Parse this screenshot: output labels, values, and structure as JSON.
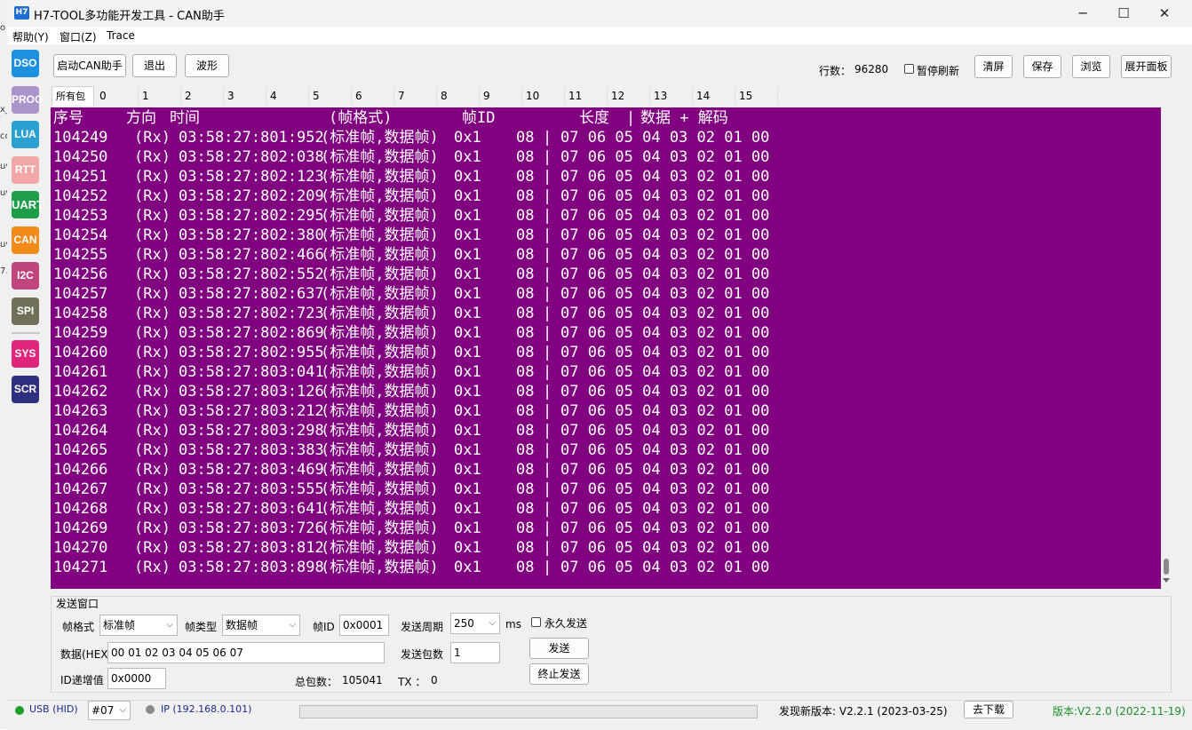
{
  "background_strip": [
    "o",
    "x_",
    "cc",
    "uv",
    "uv",
    "uv",
    "7."
  ],
  "window": {
    "logo": "H7",
    "title": "H7-TOOL多功能开发工具 - CAN助手",
    "minimize": "─",
    "maximize": "☐",
    "close": "✕"
  },
  "menu": [
    "帮助(Y)",
    "窗口(Z)",
    "Trace"
  ],
  "sidebar": [
    {
      "label": "DSO",
      "color": "#1e90e0"
    },
    {
      "label": "PROG",
      "color": "#a995c9"
    },
    {
      "label": "LUA",
      "color": "#2a9fd0"
    },
    {
      "label": "RTT",
      "color": "#f2a7a7"
    },
    {
      "label": "UART",
      "color": "#1e9e4a"
    },
    {
      "label": "CAN",
      "color": "#f08a1a"
    },
    {
      "label": "I2C",
      "color": "#c0457c"
    },
    {
      "label": "SPI",
      "color": "#6f6f5a"
    },
    {
      "label": "SYS",
      "color": "#e0257c"
    },
    {
      "label": "SCR",
      "color": "#2e2f7e"
    }
  ],
  "toolbar": {
    "start": "启动CAN助手",
    "exit": "退出",
    "wave": "波形",
    "rows_label": "行数：",
    "rows_value": "96280",
    "pause_label": "暂停刷新",
    "clear": "清屏",
    "save": "保存",
    "browse": "浏览",
    "expand": "展开面板"
  },
  "tabs": [
    "所有包",
    "0",
    "1",
    "2",
    "3",
    "4",
    "5",
    "6",
    "7",
    "8",
    "9",
    "10",
    "11",
    "12",
    "13",
    "14",
    "15"
  ],
  "log": {
    "header": {
      "seq": "序号",
      "dir": "方向",
      "time": "时间",
      "fmt": "(帧格式)",
      "id": "帧ID",
      "len": "长度",
      "sep": "|",
      "data": "数据 + 解码"
    },
    "rows": [
      {
        "seq": "104249",
        "dir": "(Rx)",
        "time": "03:58:27:801:952",
        "fmt": "(标准帧,数据帧)",
        "id": "0x1",
        "len": "08",
        "data": "07 06 05 04 03 02 01 00"
      },
      {
        "seq": "104250",
        "dir": "(Rx)",
        "time": "03:58:27:802:038",
        "fmt": "(标准帧,数据帧)",
        "id": "0x1",
        "len": "08",
        "data": "07 06 05 04 03 02 01 00"
      },
      {
        "seq": "104251",
        "dir": "(Rx)",
        "time": "03:58:27:802:123",
        "fmt": "(标准帧,数据帧)",
        "id": "0x1",
        "len": "08",
        "data": "07 06 05 04 03 02 01 00"
      },
      {
        "seq": "104252",
        "dir": "(Rx)",
        "time": "03:58:27:802:209",
        "fmt": "(标准帧,数据帧)",
        "id": "0x1",
        "len": "08",
        "data": "07 06 05 04 03 02 01 00"
      },
      {
        "seq": "104253",
        "dir": "(Rx)",
        "time": "03:58:27:802:295",
        "fmt": "(标准帧,数据帧)",
        "id": "0x1",
        "len": "08",
        "data": "07 06 05 04 03 02 01 00"
      },
      {
        "seq": "104254",
        "dir": "(Rx)",
        "time": "03:58:27:802:380",
        "fmt": "(标准帧,数据帧)",
        "id": "0x1",
        "len": "08",
        "data": "07 06 05 04 03 02 01 00"
      },
      {
        "seq": "104255",
        "dir": "(Rx)",
        "time": "03:58:27:802:466",
        "fmt": "(标准帧,数据帧)",
        "id": "0x1",
        "len": "08",
        "data": "07 06 05 04 03 02 01 00"
      },
      {
        "seq": "104256",
        "dir": "(Rx)",
        "time": "03:58:27:802:552",
        "fmt": "(标准帧,数据帧)",
        "id": "0x1",
        "len": "08",
        "data": "07 06 05 04 03 02 01 00"
      },
      {
        "seq": "104257",
        "dir": "(Rx)",
        "time": "03:58:27:802:637",
        "fmt": "(标准帧,数据帧)",
        "id": "0x1",
        "len": "08",
        "data": "07 06 05 04 03 02 01 00"
      },
      {
        "seq": "104258",
        "dir": "(Rx)",
        "time": "03:58:27:802:723",
        "fmt": "(标准帧,数据帧)",
        "id": "0x1",
        "len": "08",
        "data": "07 06 05 04 03 02 01 00"
      },
      {
        "seq": "104259",
        "dir": "(Rx)",
        "time": "03:58:27:802:869",
        "fmt": "(标准帧,数据帧)",
        "id": "0x1",
        "len": "08",
        "data": "07 06 05 04 03 02 01 00"
      },
      {
        "seq": "104260",
        "dir": "(Rx)",
        "time": "03:58:27:802:955",
        "fmt": "(标准帧,数据帧)",
        "id": "0x1",
        "len": "08",
        "data": "07 06 05 04 03 02 01 00"
      },
      {
        "seq": "104261",
        "dir": "(Rx)",
        "time": "03:58:27:803:041",
        "fmt": "(标准帧,数据帧)",
        "id": "0x1",
        "len": "08",
        "data": "07 06 05 04 03 02 01 00"
      },
      {
        "seq": "104262",
        "dir": "(Rx)",
        "time": "03:58:27:803:126",
        "fmt": "(标准帧,数据帧)",
        "id": "0x1",
        "len": "08",
        "data": "07 06 05 04 03 02 01 00"
      },
      {
        "seq": "104263",
        "dir": "(Rx)",
        "time": "03:58:27:803:212",
        "fmt": "(标准帧,数据帧)",
        "id": "0x1",
        "len": "08",
        "data": "07 06 05 04 03 02 01 00"
      },
      {
        "seq": "104264",
        "dir": "(Rx)",
        "time": "03:58:27:803:298",
        "fmt": "(标准帧,数据帧)",
        "id": "0x1",
        "len": "08",
        "data": "07 06 05 04 03 02 01 00"
      },
      {
        "seq": "104265",
        "dir": "(Rx)",
        "time": "03:58:27:803:383",
        "fmt": "(标准帧,数据帧)",
        "id": "0x1",
        "len": "08",
        "data": "07 06 05 04 03 02 01 00"
      },
      {
        "seq": "104266",
        "dir": "(Rx)",
        "time": "03:58:27:803:469",
        "fmt": "(标准帧,数据帧)",
        "id": "0x1",
        "len": "08",
        "data": "07 06 05 04 03 02 01 00"
      },
      {
        "seq": "104267",
        "dir": "(Rx)",
        "time": "03:58:27:803:555",
        "fmt": "(标准帧,数据帧)",
        "id": "0x1",
        "len": "08",
        "data": "07 06 05 04 03 02 01 00"
      },
      {
        "seq": "104268",
        "dir": "(Rx)",
        "time": "03:58:27:803:641",
        "fmt": "(标准帧,数据帧)",
        "id": "0x1",
        "len": "08",
        "data": "07 06 05 04 03 02 01 00"
      },
      {
        "seq": "104269",
        "dir": "(Rx)",
        "time": "03:58:27:803:726",
        "fmt": "(标准帧,数据帧)",
        "id": "0x1",
        "len": "08",
        "data": "07 06 05 04 03 02 01 00"
      },
      {
        "seq": "104270",
        "dir": "(Rx)",
        "time": "03:58:27:803:812",
        "fmt": "(标准帧,数据帧)",
        "id": "0x1",
        "len": "08",
        "data": "07 06 05 04 03 02 01 00"
      },
      {
        "seq": "104271",
        "dir": "(Rx)",
        "time": "03:58:27:803:898",
        "fmt": "(标准帧,数据帧)",
        "id": "0x1",
        "len": "08",
        "data": "07 06 05 04 03 02 01 00"
      }
    ],
    "row_separator": "|",
    "background_color": "#800080"
  },
  "send": {
    "title": "发送窗口",
    "frame_format_label": "帧格式",
    "frame_format_value": "标准帧",
    "frame_type_label": "帧类型",
    "frame_type_value": "数据帧",
    "frame_id_label": "帧ID",
    "frame_id_value": "0x0001",
    "period_label": "发送周期",
    "period_value": "250",
    "period_unit": "ms",
    "forever_label": "永久发送",
    "data_label": "数据(HEX)",
    "data_value": "00 01 02 03 04 05 06 07",
    "count_label": "发送包数",
    "count_value": "1",
    "send_button": "发送",
    "id_inc_label": "ID递增值",
    "id_inc_value": "0x0000",
    "total_label": "总包数：",
    "total_value": "105041",
    "tx_label": "TX ：",
    "tx_value": "0",
    "stop_button": "终止发送"
  },
  "status": {
    "usb_label": "USB (HID)",
    "usb_color": "#1e9e2a",
    "device_value": "#07",
    "ip_label": "IP (192.168.0.101)",
    "ip_color": "#8a8a8a",
    "update_text": "发现新版本: V2.2.1 (2023-03-25)",
    "download_button": "去下载",
    "version_text": "版本:V2.2.0 (2022-11-19)",
    "version_color": "#1e8e2a"
  }
}
